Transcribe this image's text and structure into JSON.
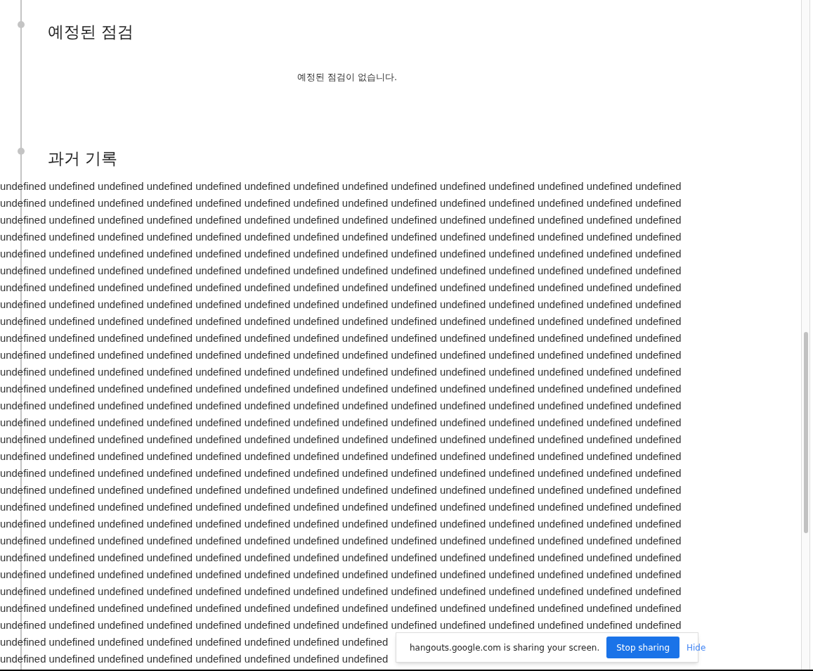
{
  "upcoming": {
    "title": "예정된 점검",
    "empty_message": "예정된 점검이 없습니다."
  },
  "history": {
    "title": "과거 기록",
    "lines": [
      "undefined undefined undefined undefined undefined undefined undefined undefined undefined undefined undefined undefined undefined undefined",
      "undefined undefined undefined undefined undefined undefined undefined undefined undefined undefined undefined undefined undefined undefined",
      "undefined undefined undefined undefined undefined undefined undefined undefined undefined undefined undefined undefined undefined undefined",
      "undefined undefined undefined undefined undefined undefined undefined undefined undefined undefined undefined undefined undefined undefined",
      "undefined undefined undefined undefined undefined undefined undefined undefined undefined undefined undefined undefined undefined undefined",
      "undefined undefined undefined undefined undefined undefined undefined undefined undefined undefined undefined undefined undefined undefined",
      "undefined undefined undefined undefined undefined undefined undefined undefined undefined undefined undefined undefined undefined undefined",
      "undefined undefined undefined undefined undefined undefined undefined undefined undefined undefined undefined undefined undefined undefined",
      "undefined undefined undefined undefined undefined undefined undefined undefined undefined undefined undefined undefined undefined undefined",
      "undefined undefined undefined undefined undefined undefined undefined undefined undefined undefined undefined undefined undefined undefined",
      "undefined undefined undefined undefined undefined undefined undefined undefined undefined undefined undefined undefined undefined undefined",
      "undefined undefined undefined undefined undefined undefined undefined undefined undefined undefined undefined undefined undefined undefined",
      "undefined undefined undefined undefined undefined undefined undefined undefined undefined undefined undefined undefined undefined undefined",
      "undefined undefined undefined undefined undefined undefined undefined undefined undefined undefined undefined undefined undefined undefined",
      "undefined undefined undefined undefined undefined undefined undefined undefined undefined undefined undefined undefined undefined undefined",
      "undefined undefined undefined undefined undefined undefined undefined undefined undefined undefined undefined undefined undefined undefined",
      "undefined undefined undefined undefined undefined undefined undefined undefined undefined undefined undefined undefined undefined undefined",
      "undefined undefined undefined undefined undefined undefined undefined undefined undefined undefined undefined undefined undefined undefined",
      "undefined undefined undefined undefined undefined undefined undefined undefined undefined undefined undefined undefined undefined undefined",
      "undefined undefined undefined undefined undefined undefined undefined undefined undefined undefined undefined undefined undefined undefined",
      "undefined undefined undefined undefined undefined undefined undefined undefined undefined undefined undefined undefined undefined undefined",
      "undefined undefined undefined undefined undefined undefined undefined undefined undefined undefined undefined undefined undefined undefined",
      "undefined undefined undefined undefined undefined undefined undefined undefined undefined undefined undefined undefined undefined undefined",
      "undefined undefined undefined undefined undefined undefined undefined undefined undefined undefined undefined undefined undefined undefined",
      "undefined undefined undefined undefined undefined undefined undefined undefined undefined undefined undefined undefined undefined undefined",
      "undefined undefined undefined undefined undefined undefined undefined undefined undefined undefined undefined undefined undefined undefined",
      "undefined undefined undefined undefined undefined undefined undefined undefined undefined undefined undefined undefined undefined undefined",
      "undefined undefined undefined undefined undefined undefined undefined undefined",
      "undefined undefined undefined undefined undefined undefined undefined undefined"
    ]
  },
  "share_bar": {
    "message": "hangouts.google.com is sharing your screen.",
    "stop_button": "Stop sharing",
    "hide_link": "Hide"
  }
}
